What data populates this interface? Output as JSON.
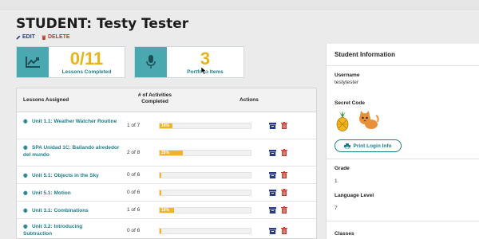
{
  "page": {
    "title": "STUDENT: Testy Tester",
    "edit_label": "EDIT",
    "delete_label": "DELETE"
  },
  "stats": [
    {
      "value": "0/11",
      "label": "Lessons Completed",
      "icon": "chart-icon"
    },
    {
      "value": "3",
      "label": "Portfolio Items",
      "icon": "microphone-icon"
    }
  ],
  "table": {
    "headers": {
      "lessons": "Lessons Assigned",
      "activities": "# of Activities Completed",
      "actions": "Actions"
    },
    "rows": [
      {
        "lesson": "Unit 1.1: Weather Watcher Routine",
        "count": "1 of 7",
        "progress": 14,
        "progress_label": "14%"
      },
      {
        "lesson": "SPA Unidad 1C: Bailando alrededor del mundo",
        "count": "2 of 8",
        "progress": 25,
        "progress_label": "25%"
      },
      {
        "lesson": "Unit 5.1: Objects in the Sky",
        "count": "0 of 6",
        "progress": 0,
        "progress_label": ""
      },
      {
        "lesson": "Unit 5.1: Motion",
        "count": "0 of 6",
        "progress": 0,
        "progress_label": ""
      },
      {
        "lesson": "Unit 3.1: Combinations",
        "count": "1 of 6",
        "progress": 16,
        "progress_label": "16%"
      },
      {
        "lesson": "Unit 3.2: Introducing Subtraction",
        "count": "0 of 6",
        "progress": 0,
        "progress_label": ""
      }
    ]
  },
  "sidebar": {
    "title": "Student Information",
    "username_label": "Username",
    "username": "testytester",
    "secret_code_label": "Secret Code",
    "secret_code_icons": [
      "pineapple-icon",
      "cat-icon"
    ],
    "print_label": "Print Login Info",
    "grade_label": "Grade",
    "grade": "1",
    "language_label": "Language Level",
    "language_level": "7",
    "classes_label": "Classes"
  },
  "colors": {
    "accent": "#1e7e89",
    "icon_tile": "#4aa8b0",
    "stat_value": "#e8b41c",
    "progress": "#f0b429",
    "archive": "#2a3a8a",
    "delete": "#c0392b"
  }
}
